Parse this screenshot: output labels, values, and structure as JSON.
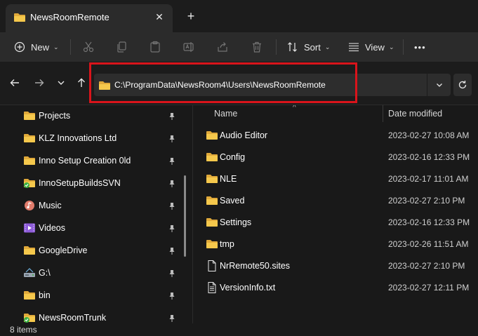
{
  "window": {
    "tab_title": "NewsRoomRemote",
    "close_glyph": "✕",
    "new_tab_glyph": "+"
  },
  "toolbar": {
    "new_label": "New",
    "sort_label": "Sort",
    "view_label": "View",
    "more_glyph": "•••",
    "chevron_glyph": "⌄",
    "icons": [
      "plus-circle-icon",
      "cut-icon",
      "copy-icon",
      "paste-icon",
      "rename-icon",
      "share-icon",
      "delete-icon",
      "sort-icon",
      "view-icon",
      "more-icon"
    ]
  },
  "address": {
    "path": "C:\\ProgramData\\NewsRoom4\\Users\\NewsRoomRemote"
  },
  "navigation": {
    "items": [
      {
        "label": "Projects",
        "icon": "folder-icon",
        "pinned": true
      },
      {
        "label": "KLZ Innovations Ltd",
        "icon": "folder-icon",
        "pinned": true
      },
      {
        "label": "Inno Setup Creation 0ld",
        "icon": "folder-icon",
        "pinned": true
      },
      {
        "label": "InnoSetupBuildsSVN",
        "icon": "svn-folder-icon",
        "pinned": true
      },
      {
        "label": "Music",
        "icon": "music-icon",
        "pinned": true
      },
      {
        "label": "Videos",
        "icon": "videos-icon",
        "pinned": true
      },
      {
        "label": "GoogleDrive",
        "icon": "folder-icon",
        "pinned": true
      },
      {
        "label": "G:\\",
        "icon": "drive-icon",
        "pinned": true
      },
      {
        "label": "bin",
        "icon": "folder-icon",
        "pinned": true
      },
      {
        "label": "NewsRoomTrunk",
        "icon": "svn-folder-icon",
        "pinned": true
      }
    ]
  },
  "file_list": {
    "columns": {
      "name": "Name",
      "date_modified": "Date modified"
    },
    "sort_glyph": "^",
    "rows": [
      {
        "name": "Audio Editor",
        "date": "2023-02-27 10:08 AM",
        "type": "folder"
      },
      {
        "name": "Config",
        "date": "2023-02-16 12:33 PM",
        "type": "folder"
      },
      {
        "name": "NLE",
        "date": "2023-02-17 11:01 AM",
        "type": "folder"
      },
      {
        "name": "Saved",
        "date": "2023-02-27 2:10 PM",
        "type": "folder"
      },
      {
        "name": "Settings",
        "date": "2023-02-16 12:33 PM",
        "type": "folder"
      },
      {
        "name": "tmp",
        "date": "2023-02-26 11:51 AM",
        "type": "folder"
      },
      {
        "name": "NrRemote50.sites",
        "date": "2023-02-27 2:10 PM",
        "type": "file"
      },
      {
        "name": "VersionInfo.txt",
        "date": "2023-02-27 12:11 PM",
        "type": "text-file"
      }
    ]
  },
  "status": {
    "item_count": "8 items"
  },
  "colors": {
    "folder": "#f2c14e",
    "annotation_box": "#d9141b",
    "svn_badge": "#3cb043"
  }
}
